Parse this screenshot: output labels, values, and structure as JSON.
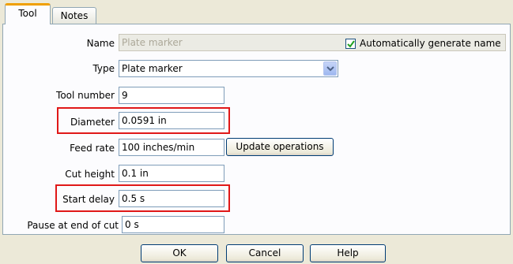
{
  "tabs": [
    {
      "label": "Tool"
    },
    {
      "label": "Notes"
    }
  ],
  "form": {
    "name": {
      "label": "Name",
      "value": "Plate marker"
    },
    "type": {
      "label": "Type",
      "value": "Plate marker"
    },
    "auto_name": {
      "label": "Automatically generate name",
      "checked": true
    },
    "tool_number": {
      "label": "Tool number",
      "value": "9"
    },
    "diameter": {
      "label": "Diameter",
      "value": "0.0591 in"
    },
    "feed_rate": {
      "label": "Feed rate",
      "value": "100 inches/min"
    },
    "update_operations": {
      "label": "Update operations"
    },
    "cut_height": {
      "label": "Cut height",
      "value": "0.1 in"
    },
    "start_delay": {
      "label": "Start delay",
      "value": "0.5 s"
    },
    "pause_end": {
      "label": "Pause at end of cut",
      "value": "0 s"
    }
  },
  "buttons": {
    "ok": "OK",
    "cancel": "Cancel",
    "help": "Help"
  },
  "colors": {
    "highlight": "#e01818",
    "active_tab_accent": "#f0a000"
  }
}
